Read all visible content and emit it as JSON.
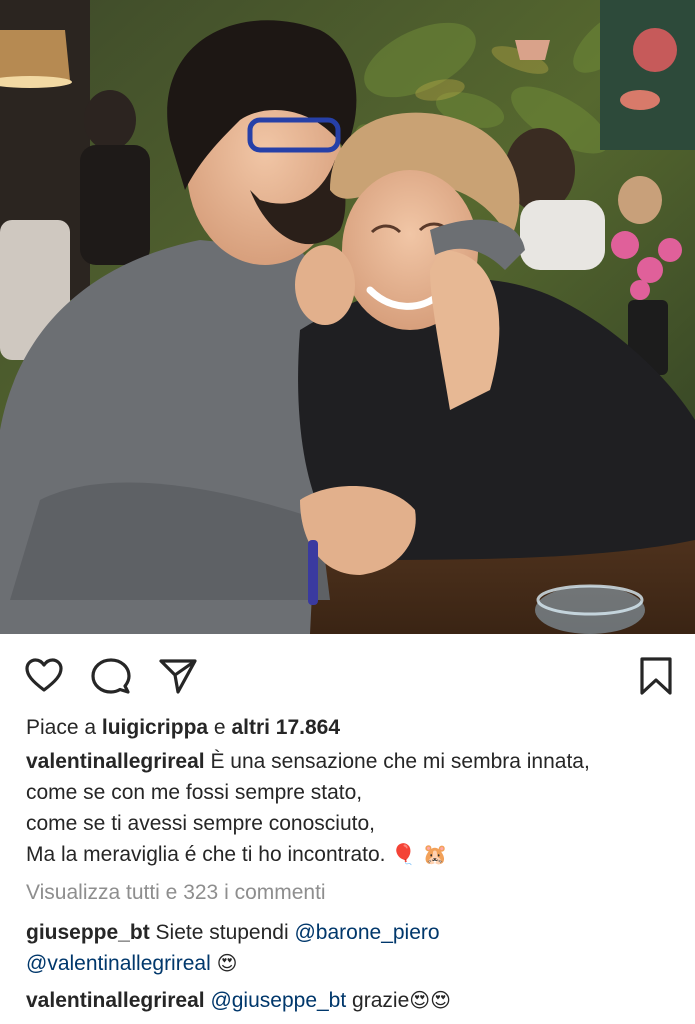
{
  "post": {
    "photo_alt": "Post photo",
    "likes": {
      "prefix": "Piace a",
      "first_user": "luigicrippa",
      "conjunction": "e",
      "others": "altri 17.864"
    },
    "caption": {
      "username": "valentinallegrireal",
      "line1": "È una sensazione che mi sembra innata,",
      "line2": "come se con me fossi sempre stato,",
      "line3": "come se ti avessi sempre conosciuto,",
      "line4": "Ma la meraviglia é che ti ho incontrato.",
      "line4_emoji": "🎈 🐹"
    },
    "view_comments": "Visualizza tutti e 323 i commenti",
    "comments": [
      {
        "username": "giuseppe_bt",
        "text": "Siete stupendi",
        "mention1": "@barone_piero",
        "mention2": "@valentinallegrireal",
        "emoji": "😍"
      },
      {
        "username": "valentinallegrireal",
        "mention": "@giuseppe_bt",
        "text": "grazie",
        "emoji": "😍😍"
      }
    ]
  },
  "icons": {
    "like": "heart-icon",
    "comment": "comment-bubble-icon",
    "share": "paper-plane-icon",
    "save": "bookmark-icon"
  },
  "colors": {
    "text": "#262626",
    "secondary": "#8e8e8e",
    "mention": "#00376b"
  }
}
